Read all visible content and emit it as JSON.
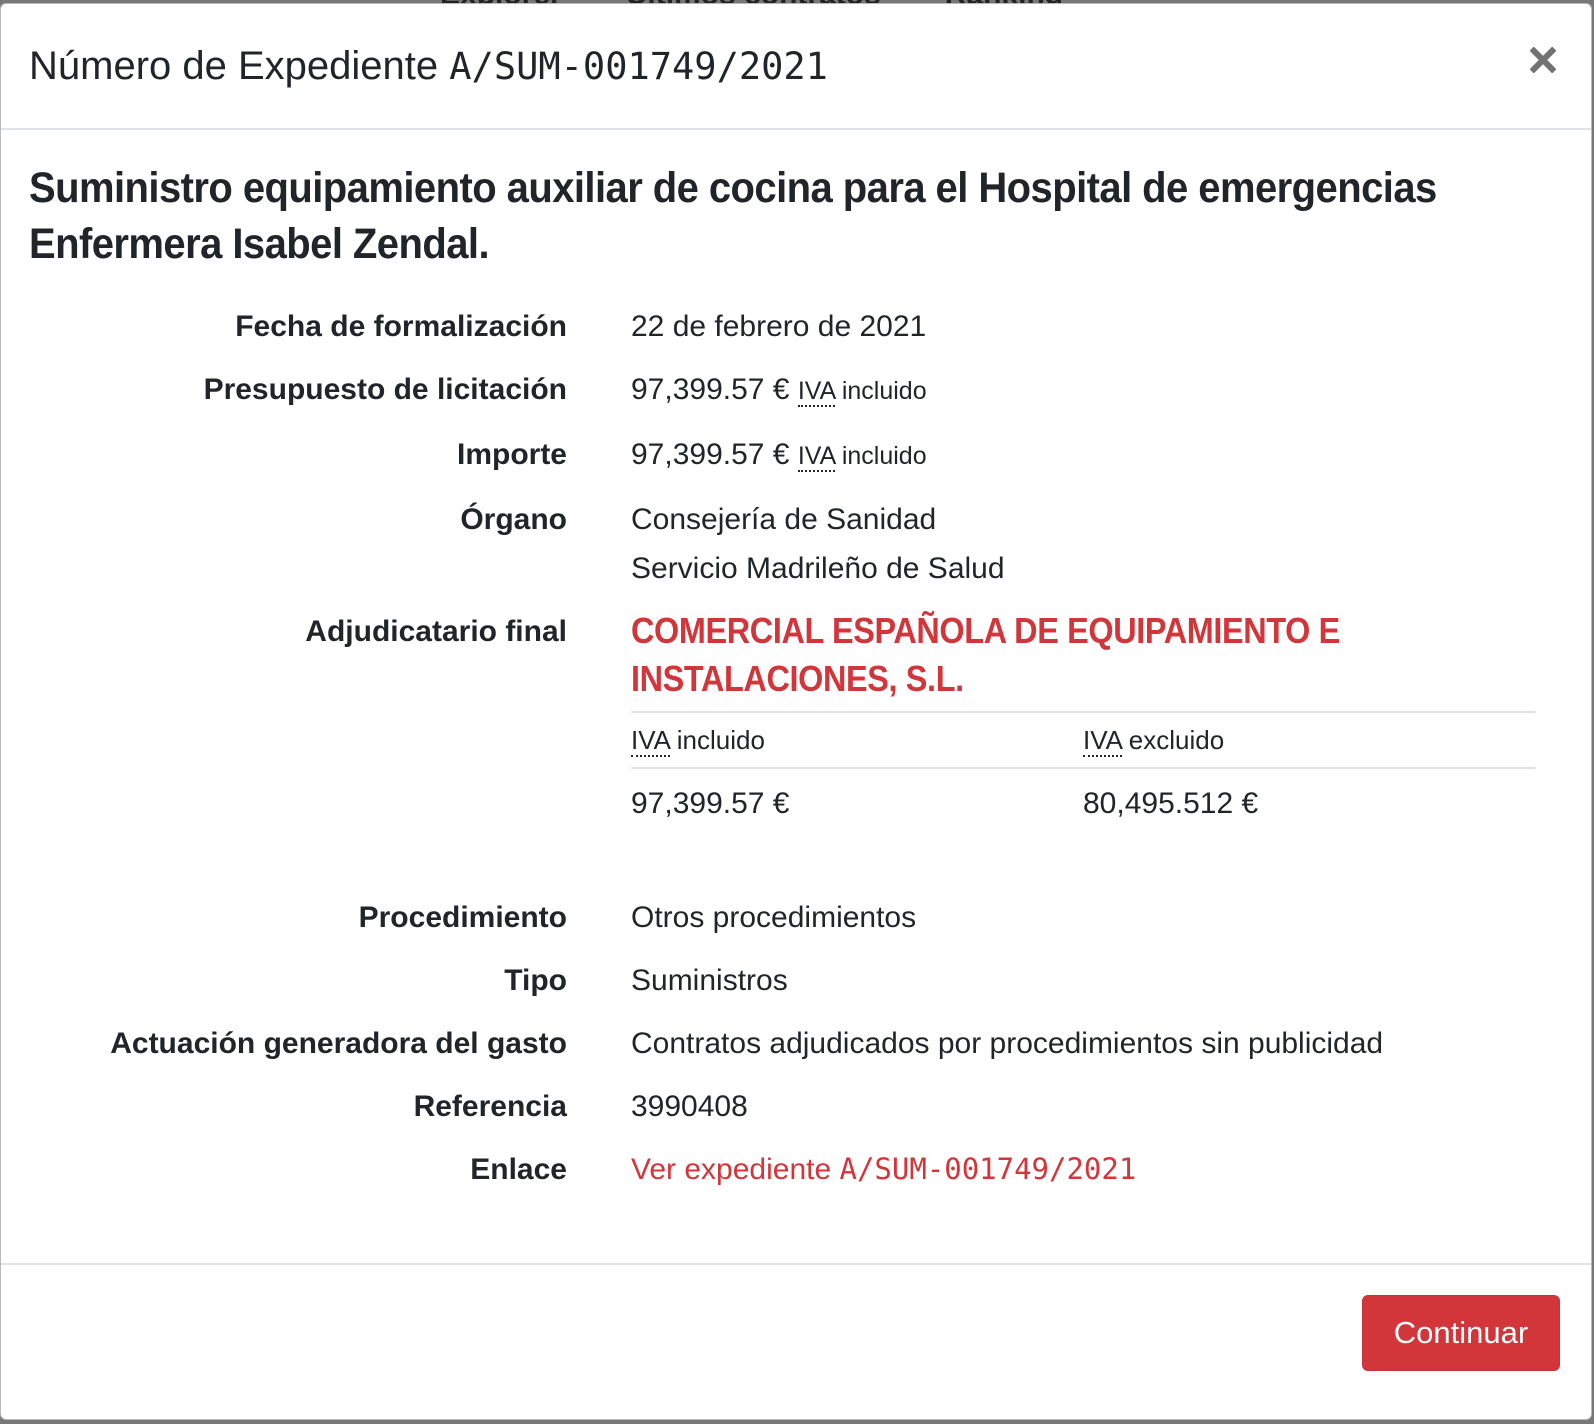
{
  "background": {
    "nav_items": [
      "Explorer",
      "Últimos contratos",
      "Ranking"
    ]
  },
  "modal": {
    "title_prefix": "Número de Expediente ",
    "expediente": "A/SUM-001749/2021",
    "close_label": "×",
    "contract_title": "Suministro equipamiento auxiliar de cocina para el Hospital de emergencias Enfermera Isabel Zendal.",
    "fields": {
      "fecha_label": "Fecha de formalización",
      "fecha_value": "22 de febrero de 2021",
      "presupuesto_label": "Presupuesto de licitación",
      "presupuesto_value": "97,399.57 €",
      "importe_label": "Importe",
      "importe_value": "97,399.57 €",
      "iva_abbr": "IVA",
      "iva_incluido_suffix": " incluido",
      "organo_label": "Órgano",
      "organo_line1": "Consejería de Sanidad",
      "organo_line2": "Servicio Madrileño de Salud",
      "adjudicatario_label": "Adjudicatario final",
      "adjudicatario_value": "COMERCIAL ESPAÑOLA DE EQUIPAMIENTO E INSTALACIONES, S.L.",
      "table": {
        "col1_suffix": " incluido",
        "col2_suffix": " excluido",
        "val_incluido": "97,399.57 €",
        "val_excluido": "80,495.512 €"
      },
      "procedimiento_label": "Procedimiento",
      "procedimiento_value": "Otros procedimientos",
      "tipo_label": "Tipo",
      "tipo_value": "Suministros",
      "actuacion_label": "Actuación generadora del gasto",
      "actuacion_value": "Contratos adjudicados por procedimientos sin publicidad",
      "referencia_label": "Referencia",
      "referencia_value": "3990408",
      "enlace_label": "Enlace",
      "enlace_prefix": "Ver expediente ",
      "enlace_expediente": "A/SUM-001749/2021"
    },
    "footer": {
      "continue_label": "Continuar"
    }
  },
  "colors": {
    "accent": "#d2353a",
    "text": "#212529",
    "divider": "#dee2e6"
  }
}
